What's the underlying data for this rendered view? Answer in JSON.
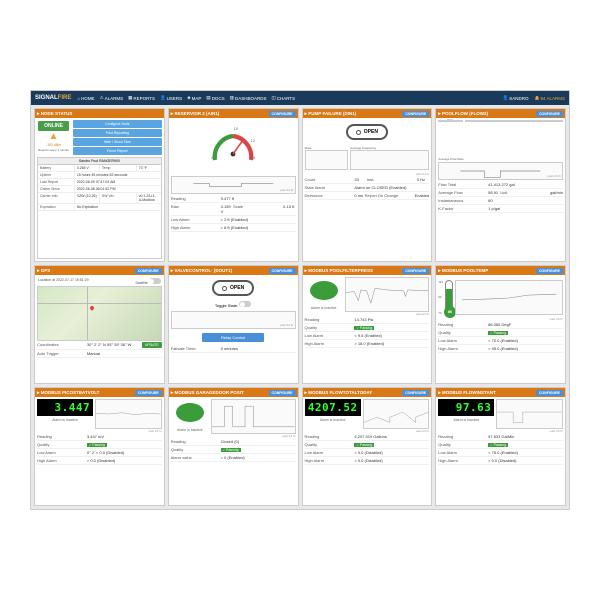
{
  "brand": {
    "name": "SIGNAL",
    "suffix": "FIRE"
  },
  "nav": {
    "home": "HOME",
    "alarms": "ALARMS",
    "reports": "REPORTS",
    "users": "USERS",
    "map": "MAP",
    "docs": "DOCS",
    "dashboards": "DASHBOARDS",
    "charts": "CHARTS"
  },
  "user": {
    "name": "SANDRO"
  },
  "alarmCount": {
    "label": "94 ALARMS"
  },
  "configure": "CONFIGURE",
  "nodeStatus": {
    "title": "NODE STATUS",
    "online": "ONLINE",
    "rssi": "-102 dBm",
    "reports": "Reports every 1 minute",
    "btns": {
      "conf": "Configure Node",
      "past": "Past Reporting",
      "hide": "Hide / Show Tiles",
      "force": "Force Report"
    },
    "device": "Sandro Pool RANGER900",
    "battery_l": "Battery",
    "battery": "3.265 V",
    "temp_l": "Temp",
    "temp": "73 °F",
    "uptime_l": "Uptime",
    "uptime": "15 hours 45 minutes 52 seconds",
    "lastrep_l": "Last Report",
    "lastrep": "2022-06-09 07:47:02 AM",
    "since_l": "Online Since",
    "since": "2022-06-08 06:01:52 PM",
    "carrier_l": "Carrier Info",
    "carrier": "VZW (10,26)",
    "swver_l": "SW Ver",
    "swver": "v0.1.24-r1-A-Modbus",
    "exp_l": "Expiration",
    "exp": "No Expiration"
  },
  "reservoir": {
    "title": "RESERVOIR 2 (AIN1)",
    "reading_l": "Reading",
    "reading": "9.477 ft",
    "raw_l": "Raw",
    "raw": "3.159 V",
    "scale_l": "Scale",
    "scale": "0-15 ft",
    "low_l": "Low Alarm",
    "low": "< 2 ft (Enabled)",
    "high_l": "High Alarm",
    "high": "> 8 ft (Enabled)",
    "gauge": {
      "min": "4",
      "max": "14",
      "mid1": "8",
      "mid2": "10",
      "mid3": "12"
    }
  },
  "pumpFailure": {
    "title": "PUMP FAILURE (DIN1)",
    "open": "OPEN",
    "state_l": "State",
    "avgfreq_l": "Average Frequency",
    "count_l": "Count",
    "count": "33",
    "inst_l": "Inst.",
    "inst": "0 Hz",
    "statealarm_l": "State Alarm",
    "statealarm": "Alarm on CLOSED (Enabled)",
    "debounce_l": "Debounce",
    "debounce": "0 ms",
    "report_l": "Report On Change",
    "report": "Enabled"
  },
  "poolflow": {
    "title": "POOLFLOW (FLOW2)",
    "avgrate_l": "Average Flow Rate",
    "totflow_l": "Total Flow",
    "avgrate2_l": "Average Flow Rate",
    "flowtot_l": "Flow Total",
    "flowtot": "41,413.272 gal",
    "avg_l": "Average Flow",
    "avg": "58.91",
    "unit_l": "Unit",
    "unit": "gal/min",
    "inst_l": "Instantaneous",
    "inst": "60",
    "kfac_l": "K-Factor",
    "kfac": "1 p/gal"
  },
  "gps": {
    "title": "GPS",
    "loc_l": "Location at 2022-07-17 15:51:29",
    "sat": "Satellite",
    "coord_l": "Coordinates",
    "coord": "30° 2' 2'' N 95° 39' 36'' W",
    "update": "UPDATE",
    "trig_l": "Auto Trigger",
    "trig": "Manual"
  },
  "valve": {
    "title": "VALVECONTROL· (DOUT1)",
    "open": "OPEN",
    "toggle_l": "Toggle State:",
    "relay": "Relay Control",
    "failsafe_l": "Failsafe Timer",
    "failsafe": "5 minutes"
  },
  "filterpress": {
    "title": "MODBUS POOLFILTERPRESS",
    "inactive": "Alarm is Inactive",
    "reading_l": "Reading",
    "reading": "14.743 Psi",
    "quality_l": "Quality",
    "quality": "Passing",
    "low_l": "Low Alarm",
    "low": "< 9.5 (Enabled)",
    "high_l": "High Alarm",
    "high": "> 18.0 (Enabled)"
  },
  "pooltemp": {
    "title": "MODBUS POOLTEMP",
    "value": "86",
    "scale_hi": "110",
    "scale_mid": "90",
    "scale_lo": "70",
    "reading_l": "Reading",
    "reading": "86.065 DegF",
    "quality_l": "Quality",
    "quality": "Passing",
    "low_l": "Low Alarm",
    "low": "< 70.0 (Enabled)",
    "high_l": "High Alarm",
    "high": "> 95.0 (Enabled)"
  },
  "picobatt": {
    "title": "MODBUS PICOSTBATVOLT",
    "value": "3.447",
    "inactive": "Alarm is Inactive",
    "reading_l": "Reading",
    "reading": "3.447 mV",
    "quality_l": "Quality",
    "quality": "Passing",
    "low_l": "Low Alarm",
    "low": "0° 2' < 0.0 (Disabled)",
    "high_l": "High Alarm",
    "high": "> 0.0 (Disabled)"
  },
  "garage": {
    "title": "MODBUS GARAGEDOOR POSIT",
    "inactive": "Alarm is Inactive",
    "reading_l": "Reading",
    "reading": "Closed (0)",
    "quality_l": "Quality",
    "quality": "Passing",
    "alarmval_l": "Alarm value",
    "alarmval": "= 0 (Enabled)"
  },
  "flowtotal": {
    "title": "MODBUS FLOWTOTALTODAY",
    "value": "4207.52",
    "inactive": "Alarm is Inactive",
    "reading_l": "Reading",
    "reading": "4,207.519 Gallons",
    "quality_l": "Quality",
    "quality": "Passing",
    "low_l": "Low Alarm",
    "low": "< 0.0 (Disabled)",
    "high_l": "High Alarm",
    "high": "> 0.0 (Disabled)"
  },
  "flowinstant": {
    "title": "MODBUS FLOWINSTANT",
    "value": "97.63",
    "inactive": "Alarm is Inactive",
    "reading_l": "Reading",
    "reading": "97.633 Ga/Min",
    "quality_l": "Quality",
    "quality": "Passing",
    "low_l": "Low Alarm",
    "low": "< 75.0 (Enabled)",
    "high_l": "High Alarm",
    "high": "> 0.0 (Disabled)"
  }
}
